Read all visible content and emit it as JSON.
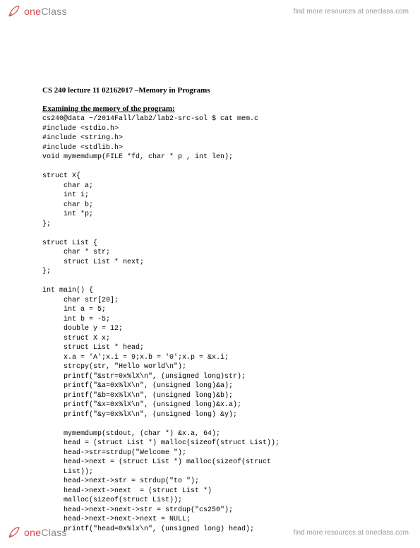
{
  "header": {
    "logoOne": "one",
    "logoClass": "Class",
    "tagline": "find more resources at oneclass.com"
  },
  "doc": {
    "title": "CS 240 lecture 11 02162017 –Memory in Programs",
    "subhead": "Examining the memory of the program:",
    "code": "cs240@data ~/2014Fall/lab2/lab2-src-sol $ cat mem.c\n#include <stdio.h>\n#include <string.h>\n#include <stdlib.h>\nvoid mymemdump(FILE *fd, char * p , int len);\n\nstruct X{\n     char a;\n     int i;\n     char b;\n     int *p;\n};\n\nstruct List {\n     char * str;\n     struct List * next;\n};\n\nint main() {\n     char str[20];\n     int a = 5;\n     int b = -5;\n     double y = 12;\n     struct X x;\n     struct List * head;\n     x.a = 'A';x.i = 9;x.b = '0';x.p = &x.i;\n     strcpy(str, \"Hello world\\n\");\n     printf(\"&str=0x%lX\\n\", (unsigned long)str);\n     printf(\"&a=0x%lX\\n\", (unsigned long)&a);\n     printf(\"&b=0x%lX\\n\", (unsigned long)&b);\n     printf(\"&x=0x%lX\\n\", (unsigned long)&x.a);\n     printf(\"&y=0x%lX\\n\", (unsigned long) &y);\n\n     mymemdump(stdout, (char *) &x.a, 64);\n     head = (struct List *) malloc(sizeof(struct List));\n     head->str=strdup(\"Welcome \");\n     head->next = (struct List *) malloc(sizeof(struct\n     List));\n     head->next->str = strdup(\"to \");\n     head->next->next  = (struct List *)\n     malloc(sizeof(struct List));\n     head->next->next->str = strdup(\"cs250\");\n     head->next->next->next = NULL;\n     printf(\"head=0x%lx\\n\", (unsigned long) head);"
  },
  "footer": {
    "logoOne": "one",
    "logoClass": "Class",
    "tagline": "find more resources at oneclass.com"
  }
}
